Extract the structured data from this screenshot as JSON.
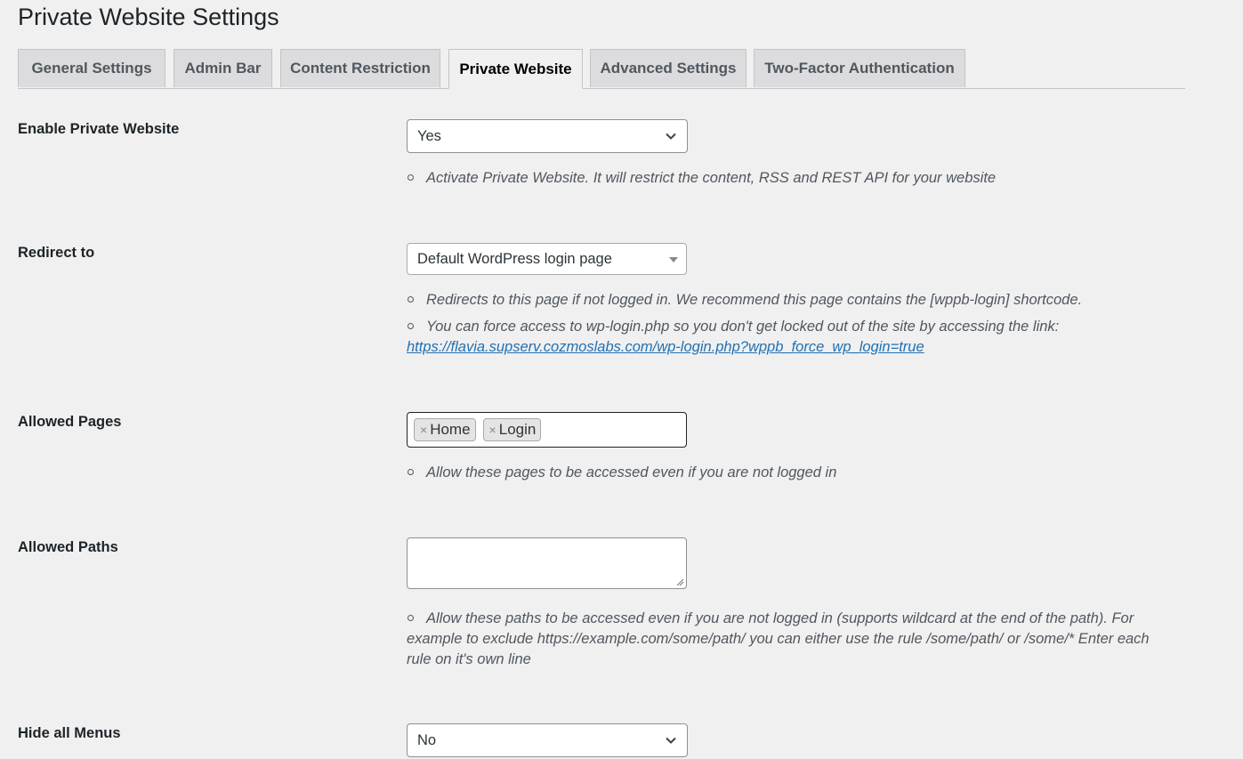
{
  "page": {
    "title": "Private Website Settings"
  },
  "tabs": [
    {
      "label": "General Settings",
      "active": false
    },
    {
      "label": "Admin Bar",
      "active": false
    },
    {
      "label": "Content Restriction",
      "active": false
    },
    {
      "label": "Private Website",
      "active": true
    },
    {
      "label": "Advanced Settings",
      "active": false
    },
    {
      "label": "Two-Factor Authentication",
      "active": false
    }
  ],
  "settings": {
    "enable": {
      "label": "Enable Private Website",
      "value": "Yes",
      "description": "Activate Private Website. It will restrict the content, RSS and REST API for your website"
    },
    "redirect": {
      "label": "Redirect to",
      "value": "Default WordPress login page",
      "description1": "Redirects to this page if not logged in. We recommend this page contains the [wppb-login] shortcode.",
      "description2": "You can force access to wp-login.php so you don't get locked out of the site by accessing the link:",
      "link": "https://flavia.supserv.cozmoslabs.com/wp-login.php?wppb_force_wp_login=true"
    },
    "allowed_pages": {
      "label": "Allowed Pages",
      "chips": [
        "Home",
        "Login"
      ],
      "remove_glyph": "×",
      "description": "Allow these pages to be accessed even if you are not logged in"
    },
    "allowed_paths": {
      "label": "Allowed Paths",
      "value": "",
      "description": "Allow these paths to be accessed even if you are not logged in (supports wildcard at the end of the path). For example to exclude https://example.com/some/path/ you can either use the rule /some/path/ or /some/* Enter each rule on it's own line"
    },
    "hide_menus": {
      "label": "Hide all Menus",
      "value": "No"
    }
  },
  "colors": {
    "link": "#2271b1",
    "background": "#f0f0f1",
    "tab_inactive": "#dcdcde"
  }
}
